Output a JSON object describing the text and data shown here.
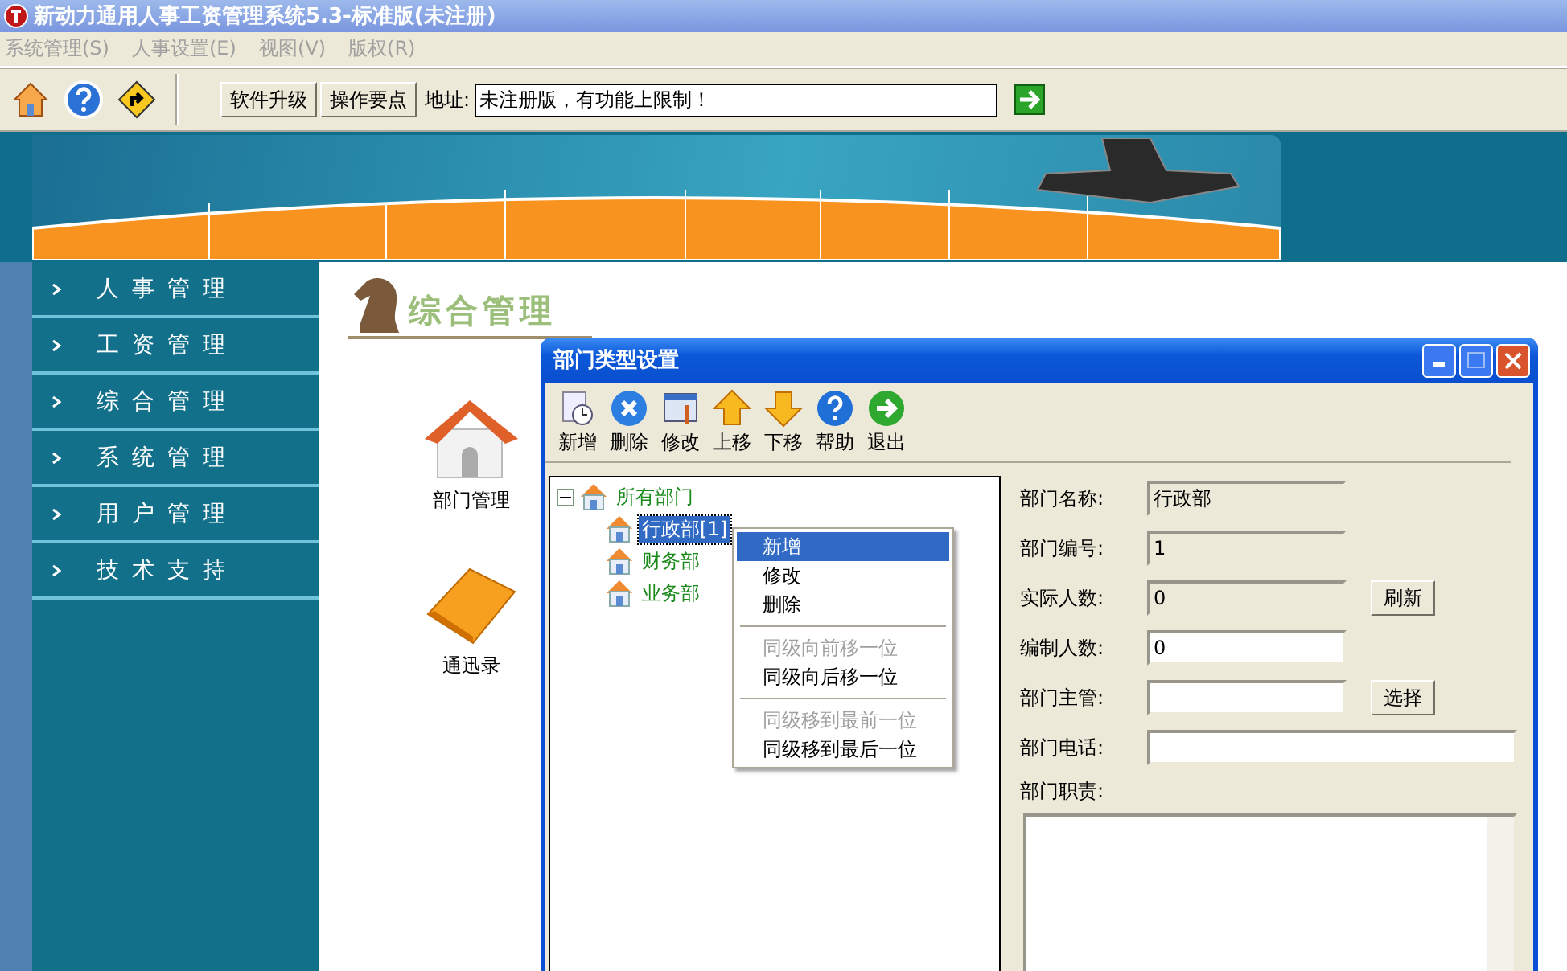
{
  "window": {
    "title": "新动力通用人事工资管理系统5.3-标准版(未注册)"
  },
  "menu": [
    {
      "label": "系统管理(S)",
      "disabled": true
    },
    {
      "label": "人事设置(E)",
      "disabled": true
    },
    {
      "label": "视图(V)",
      "disabled": true
    },
    {
      "label": "版权(R)",
      "disabled": true
    }
  ],
  "toolbar": {
    "icons": [
      {
        "kind": "home"
      },
      {
        "kind": "help"
      },
      {
        "kind": "sign"
      }
    ],
    "buttons": [
      "软件升级",
      "操作要点"
    ],
    "address_label": "地址:",
    "address_value": "未注册版，有功能上限制！"
  },
  "sidebar": {
    "items": [
      {
        "label": "人事管理"
      },
      {
        "label": "工资管理"
      },
      {
        "label": "综合管理"
      },
      {
        "label": "系统管理"
      },
      {
        "label": "用户管理"
      },
      {
        "label": "技术支持"
      }
    ]
  },
  "section_title": "综合管理",
  "shortcuts": [
    {
      "label": "部门管理",
      "kind": "house"
    },
    {
      "label": "通迅录",
      "kind": "folder"
    }
  ],
  "dialog": {
    "title": "部门类型设置",
    "tools": [
      {
        "label": "新增",
        "kind": "new"
      },
      {
        "label": "删除",
        "kind": "delete"
      },
      {
        "label": "修改",
        "kind": "edit"
      },
      {
        "label": "上移",
        "kind": "up"
      },
      {
        "label": "下移",
        "kind": "down"
      },
      {
        "label": "帮助",
        "kind": "help"
      },
      {
        "label": "退出",
        "kind": "exit"
      }
    ],
    "tree": {
      "label": "所有部门",
      "expanded": true,
      "selected": false,
      "children": [
        {
          "label": "行政部[1]",
          "selected": true
        },
        {
          "label": "财务部",
          "selected": false
        },
        {
          "label": "业务部",
          "selected": false
        }
      ]
    },
    "context_menu": [
      {
        "kind": "item",
        "label": "新增",
        "selected": true,
        "disabled": false
      },
      {
        "kind": "item",
        "label": "修改",
        "selected": false,
        "disabled": false
      },
      {
        "kind": "item",
        "label": "删除",
        "selected": false,
        "disabled": false
      },
      {
        "kind": "separator"
      },
      {
        "kind": "item",
        "label": "同级向前移一位",
        "selected": false,
        "disabled": true
      },
      {
        "kind": "item",
        "label": "同级向后移一位",
        "selected": false,
        "disabled": false
      },
      {
        "kind": "separator"
      },
      {
        "kind": "item",
        "label": "同级移到最前一位",
        "selected": false,
        "disabled": true
      },
      {
        "kind": "item",
        "label": "同级移到最后一位",
        "selected": false,
        "disabled": false
      }
    ],
    "fields": [
      {
        "label": "部门名称:",
        "value": "行政部",
        "readonly": true,
        "kind": "short"
      },
      {
        "label": "部门编号:",
        "value": "1",
        "readonly": true,
        "kind": "short"
      },
      {
        "label": "实际人数:",
        "value": "0",
        "readonly": true,
        "kind": "short",
        "button": "刷新"
      },
      {
        "label": "编制人数:",
        "value": "0",
        "readonly": false,
        "kind": "short"
      },
      {
        "label": "部门主管:",
        "readonly": false,
        "kind": "short",
        "button": "选择"
      },
      {
        "label": "部门电话:",
        "readonly": false,
        "kind": "wide"
      }
    ],
    "duty_label": "部门职责:"
  }
}
